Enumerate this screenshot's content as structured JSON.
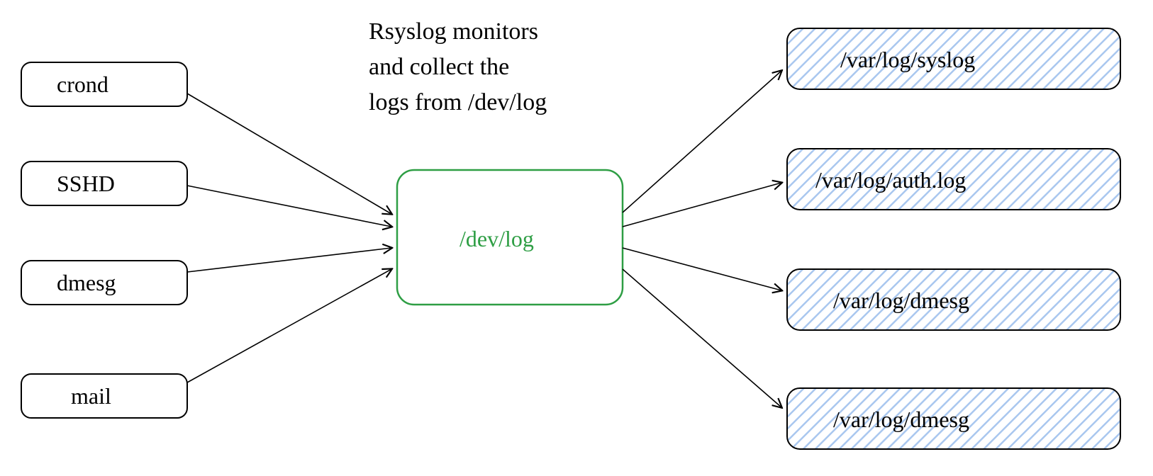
{
  "annotation": {
    "line1": "Rsyslog monitors",
    "line2": "and collect the",
    "line3": "logs from /dev/log"
  },
  "center": {
    "label": "/dev/log"
  },
  "sources": [
    {
      "label": "crond"
    },
    {
      "label": "SSHD"
    },
    {
      "label": "dmesg"
    },
    {
      "label": "mail"
    }
  ],
  "destinations": [
    {
      "label": "/var/log/syslog"
    },
    {
      "label": "/var/log/auth.log"
    },
    {
      "label": "/var/log/dmesg"
    },
    {
      "label": "/var/log/dmesg"
    }
  ]
}
